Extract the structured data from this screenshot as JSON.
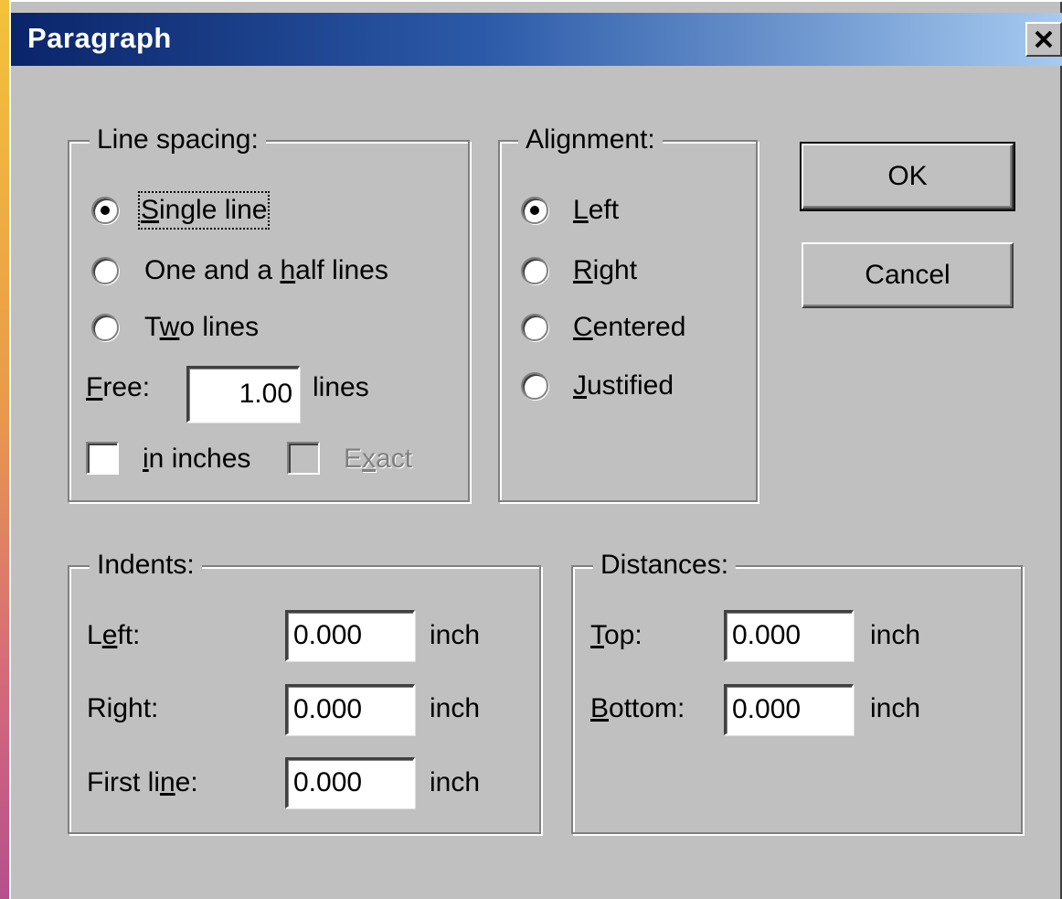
{
  "window": {
    "title": "Paragraph"
  },
  "line_spacing": {
    "legend": "Line spacing:",
    "options": [
      {
        "pre": "",
        "mn": "S",
        "post": "ingle line",
        "checked": true
      },
      {
        "pre": "One and a ",
        "mn": "h",
        "post": "alf lines",
        "checked": false
      },
      {
        "pre": "T",
        "mn": "w",
        "post": "o lines",
        "checked": false
      }
    ],
    "free_label_mn": "F",
    "free_label_rest": "ree:",
    "free_value": "1.00",
    "free_unit": "lines",
    "in_inches_mn": "i",
    "in_inches_rest": "n inches",
    "exact_pre": "E",
    "exact_mn": "x",
    "exact_post": "act"
  },
  "alignment": {
    "legend": "Alignment:",
    "options": [
      {
        "mn": "L",
        "rest": "eft",
        "checked": true
      },
      {
        "mn": "R",
        "rest": "ight",
        "checked": false
      },
      {
        "mn": "C",
        "rest": "entered",
        "checked": false
      },
      {
        "mn": "J",
        "rest": "ustified",
        "checked": false
      }
    ]
  },
  "buttons": {
    "ok": "OK",
    "cancel": "Cancel"
  },
  "indents": {
    "legend": "Indents:",
    "left_pre": "L",
    "left_mn": "e",
    "left_post": "ft:",
    "left_value": "0.000",
    "right_label": "Right:",
    "right_value": "0.000",
    "first_pre": "First li",
    "first_mn": "n",
    "first_post": "e:",
    "first_value": "0.000",
    "unit": "inch"
  },
  "distances": {
    "legend": "Distances:",
    "top_mn": "T",
    "top_rest": "op:",
    "top_value": "0.000",
    "bottom_mn": "B",
    "bottom_rest": "ottom:",
    "bottom_value": "0.000",
    "unit": "inch"
  },
  "icons": {
    "close": "close-x-icon"
  }
}
